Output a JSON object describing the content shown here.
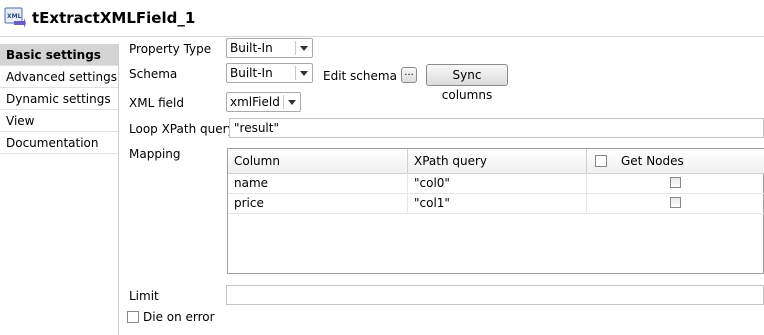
{
  "window": {
    "title": "tExtractXMLField_1",
    "icon": "xml-component-icon"
  },
  "sidebar": {
    "items": [
      {
        "label": "Basic settings",
        "active": true
      },
      {
        "label": "Advanced settings",
        "active": false
      },
      {
        "label": "Dynamic settings",
        "active": false
      },
      {
        "label": "View",
        "active": false
      },
      {
        "label": "Documentation",
        "active": false
      }
    ]
  },
  "form": {
    "property_type": {
      "label": "Property Type",
      "value": "Built-In"
    },
    "schema": {
      "label": "Schema",
      "value": "Built-In",
      "edit_label": "Edit schema",
      "edit_button": "...",
      "sync_button": "Sync columns"
    },
    "xml_field": {
      "label": "XML field",
      "value": "xmlField"
    },
    "loop_xpath": {
      "label": "Loop XPath query",
      "value": "\"result\""
    },
    "mapping": {
      "label": "Mapping",
      "columns": [
        "Column",
        "XPath query",
        "Get Nodes"
      ],
      "rows": [
        {
          "column": "name",
          "xpath": "\"col0\"",
          "get_nodes": false
        },
        {
          "column": "price",
          "xpath": "\"col1\"",
          "get_nodes": false
        }
      ]
    },
    "limit": {
      "label": "Limit",
      "value": ""
    },
    "die_on_error": {
      "label": "Die on error",
      "checked": false
    }
  }
}
